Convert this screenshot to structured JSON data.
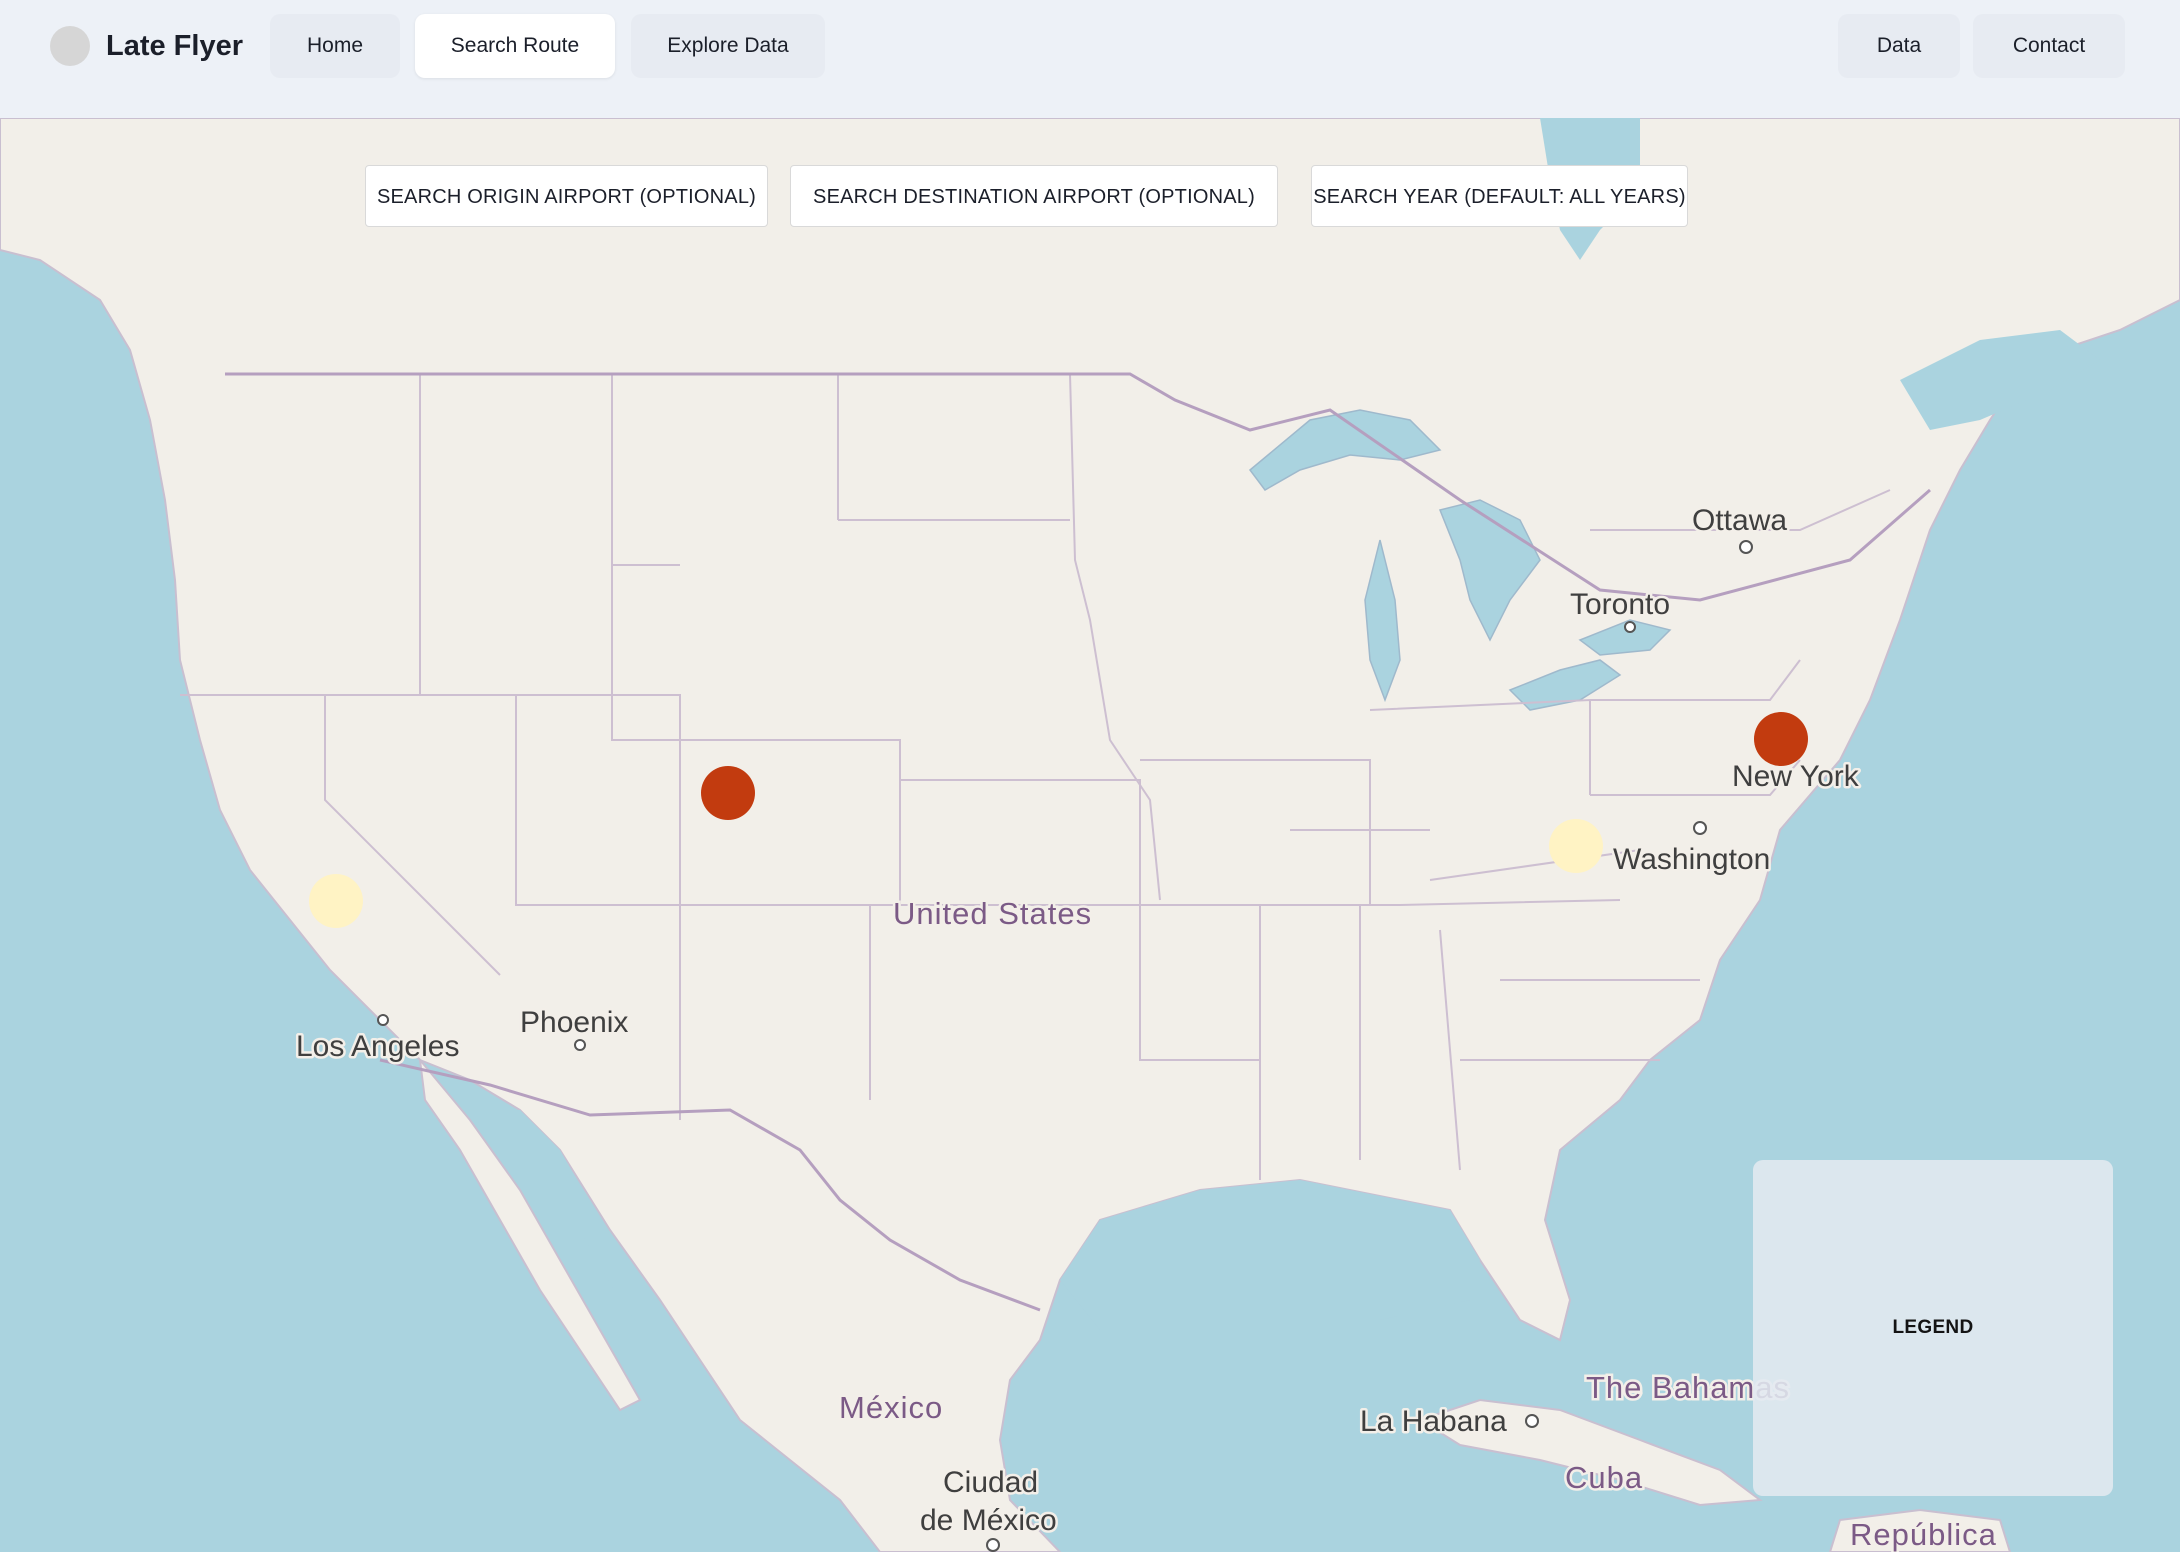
{
  "app": {
    "title": "Late Flyer"
  },
  "nav": {
    "items": [
      {
        "label": "Home",
        "active": false
      },
      {
        "label": "Search Route",
        "active": true
      },
      {
        "label": "Explore Data",
        "active": false
      }
    ],
    "right_items": [
      {
        "label": "Data"
      },
      {
        "label": "Contact"
      }
    ]
  },
  "search": {
    "origin_placeholder": "SEARCH ORIGIN AIRPORT (OPTIONAL)",
    "destination_placeholder": "SEARCH DESTINATION AIRPORT (OPTIONAL)",
    "year_placeholder": "SEARCH YEAR (DEFAULT: ALL YEARS)"
  },
  "map": {
    "labels": {
      "ottawa": "Ottawa",
      "toronto": "Toronto",
      "new_york": "New York",
      "washington": "Washington",
      "united_states": "United States",
      "phoenix": "Phoenix",
      "los_angeles": "Los Angeles",
      "mexico": "México",
      "ciudad_line1": "Ciudad",
      "ciudad_line2": "de México",
      "la_habana": "La Habana",
      "cuba": "Cuba",
      "bahamas": "The Bahamas",
      "republica": "República"
    },
    "markers_color_high": "#c23b0f",
    "markers_color_low": "#fff3c4"
  },
  "legend": {
    "title": "LEGEND"
  }
}
